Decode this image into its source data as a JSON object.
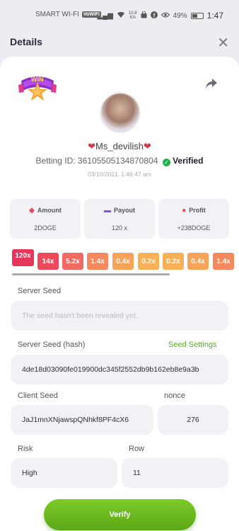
{
  "status_bar": {
    "carrier": "SMART WI-FI",
    "vowifi": "VoWiFi",
    "speed_top": "10.8",
    "speed_bottom": "K/s",
    "battery": "49%",
    "time": "1:47",
    "battery_level": 0.49,
    "icons": [
      "signal-icon",
      "wifi-icon",
      "shopping-bag-icon",
      "facebook-icon",
      "eye-icon",
      "battery-icon"
    ]
  },
  "header": {
    "title": "Details",
    "close_icon": "close-icon"
  },
  "badge": {
    "text": "WIN"
  },
  "profile": {
    "heart_left": "❤",
    "username": "Ms_devilish",
    "heart_right": "❤",
    "betting_id_label": "Betting ID:",
    "betting_id": "36105505134870804",
    "verified_label": "Verified",
    "date": "03/10/2021, 1:46:47 am"
  },
  "stats": [
    {
      "label": "Amount",
      "value": "2DOGE",
      "icon": "coins-icon",
      "color": "#e84a6a"
    },
    {
      "label": "Payout",
      "value": "120 x",
      "icon": "card-icon",
      "color": "#8a4fe0"
    },
    {
      "label": "Profit",
      "value": "+238DOGE",
      "icon": "user-up-icon",
      "color": "#e84a4a"
    }
  ],
  "multipliers": [
    {
      "label": "120x",
      "color": "#e8355c"
    },
    {
      "label": "14x",
      "color": "#ec4a5a"
    },
    {
      "label": "5.2x",
      "color": "#f06a62"
    },
    {
      "label": "1.4x",
      "color": "#f5885e"
    },
    {
      "label": "0.4x",
      "color": "#f7a45a"
    },
    {
      "label": "0.2x",
      "color": "#f8b157"
    },
    {
      "label": "0.2x",
      "color": "#f8b157"
    },
    {
      "label": "0.4x",
      "color": "#f7a45a"
    },
    {
      "label": "1.4x",
      "color": "#f5885e"
    }
  ],
  "form": {
    "server_seed_label": "Server Seed",
    "server_seed_placeholder": "The seed hasn't been revealed yet.",
    "server_seed_hash_label": "Server Seed (hash)",
    "seed_settings_link": "Seed Settings",
    "server_seed_hash": "4de18d03090fe019900dc345f2552db9b162eb8e9a3b",
    "client_seed_label": "Client Seed",
    "client_seed": "JaJ1mnXNjawspQNhkf8PF4cX6",
    "nonce_label": "nonce",
    "nonce": "276",
    "risk_label": "Risk",
    "risk": "High",
    "row_label": "Row",
    "row": "11"
  },
  "verify_label": "Verify",
  "colors": {
    "accent_green": "#6cbb22",
    "verified_green": "#21b34a"
  }
}
